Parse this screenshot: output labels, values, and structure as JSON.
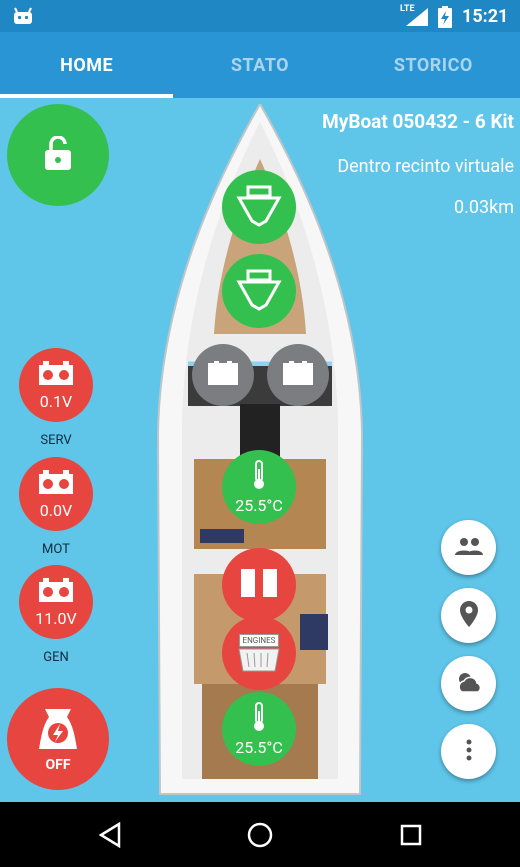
{
  "status_bar": {
    "network": "LTE",
    "time": "15:21"
  },
  "tabs": [
    {
      "label": "HOME",
      "active": true
    },
    {
      "label": "STATO",
      "active": false
    },
    {
      "label": "STORICO",
      "active": false
    }
  ],
  "boat": {
    "name": "MyBoat 050432 - 6 Kit",
    "geofence_status": "Dentro recinto virtuale",
    "distance": "0.03km"
  },
  "batteries": [
    {
      "label": "SERV",
      "value": "0.1V"
    },
    {
      "label": "MOT",
      "value": "0.0V"
    },
    {
      "label": "GEN",
      "value": "11.0V"
    }
  ],
  "generator": {
    "state": "OFF"
  },
  "sensors": {
    "temp_cabin": "25.5°C",
    "temp_engine": "25.5°C",
    "engines_label": "ENGINES"
  },
  "colors": {
    "ok": "#34c04f",
    "alarm": "#e7453f",
    "inactive": "#7b7d80",
    "background": "#5fc5e9",
    "app_bar": "#2a95d5"
  },
  "fabs": [
    "people-icon",
    "location-pin-icon",
    "weather-icon",
    "more-vert-icon"
  ]
}
